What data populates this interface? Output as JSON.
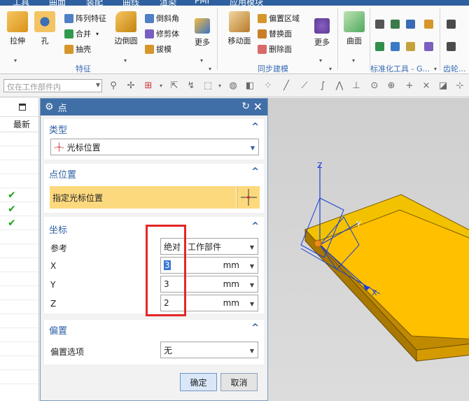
{
  "menubar": [
    "工具",
    "曲面",
    "装配",
    "曲线",
    "渲染",
    "PMI",
    "应用模块"
  ],
  "ribbon": {
    "feature_group": {
      "label": "特征",
      "extrude": "拉伸",
      "hole": "孔",
      "pattern": "阵列特征",
      "unite": "合并",
      "shell": "抽壳",
      "edge_blend": "边倒圆",
      "chamfer": "倒斜角",
      "trim_body": "修剪体",
      "draft": "拔模",
      "more": "更多"
    },
    "sync_group": {
      "label": "同步建模",
      "move_face": "移动面",
      "offset_region": "偏置区域",
      "replace_face": "替换面",
      "delete_face": "删除面",
      "more": "更多"
    },
    "surface_group": {
      "surface": "曲面"
    },
    "std_group": {
      "label": "标准化工具 - G..."
    },
    "gear_group": {
      "label": "齿轮..."
    }
  },
  "toolbar2": {
    "filter_placeholder": "仅在工作部件内"
  },
  "navigator": {
    "column": "最新"
  },
  "dialog": {
    "title": "点",
    "type_section": {
      "title": "类型",
      "value": "光标位置"
    },
    "position_section": {
      "title": "点位置",
      "prompt": "指定光标位置"
    },
    "coords_section": {
      "title": "坐标",
      "ref_label": "参考",
      "ref_mode": "绝对",
      "ref_value": "工作部件",
      "x_label": "X",
      "x_value": "3",
      "y_label": "Y",
      "y_value": "3",
      "z_label": "Z",
      "z_value": "2",
      "unit": "mm"
    },
    "offset_section": {
      "title": "偏置",
      "label": "偏置选项",
      "value": "无"
    },
    "ok": "确定",
    "cancel": "取消"
  },
  "viewport": {
    "axis_x": "X",
    "axis_y": "Y",
    "axis_z": "Z"
  }
}
